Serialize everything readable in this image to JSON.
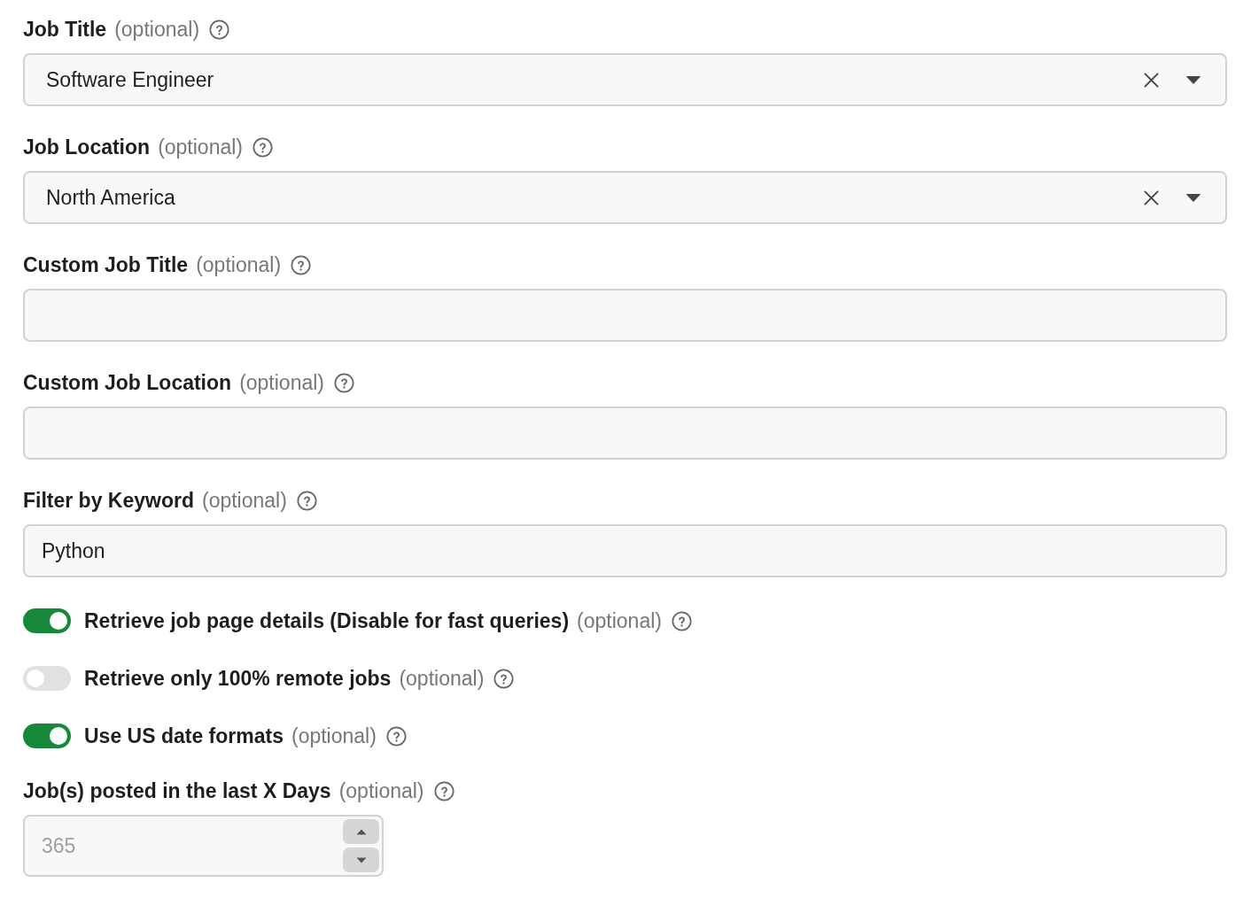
{
  "fields": [
    {
      "kind": "select",
      "label": "Job Title",
      "optional": "(optional)",
      "value": "Software Engineer"
    },
    {
      "kind": "select",
      "label": "Job Location",
      "optional": "(optional)",
      "value": "North America"
    },
    {
      "kind": "text",
      "label": "Custom Job Title",
      "optional": "(optional)"
    },
    {
      "kind": "text",
      "label": "Custom Job Location",
      "optional": "(optional)"
    },
    {
      "kind": "text",
      "label": "Filter by Keyword",
      "optional": "(optional)",
      "value": "Python"
    },
    {
      "kind": "toggle",
      "label": "Retrieve job page details (Disable for fast queries)",
      "optional": "(optional)",
      "on": true
    },
    {
      "kind": "toggle",
      "label": "Retrieve only 100% remote jobs",
      "optional": "(optional)",
      "on": false
    },
    {
      "kind": "toggle",
      "label": "Use US date formats",
      "optional": "(optional)",
      "on": true
    },
    {
      "kind": "number",
      "label": "Job(s) posted in the last X Days",
      "optional": "(optional)",
      "placeholder": "365"
    }
  ]
}
